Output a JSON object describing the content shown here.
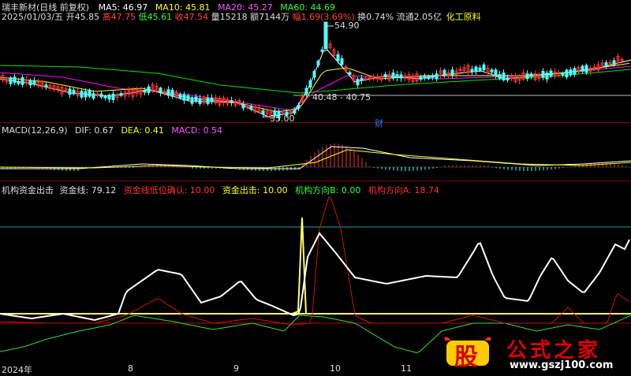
{
  "stock": {
    "title": "瑞丰新材(日线 前复权)",
    "date": "2025/01/03/五",
    "open_label": "开",
    "open_value": "45.85",
    "high_label": "高",
    "high_value": "47.75",
    "low_label": "低",
    "low_value": "45.61",
    "close_label": "收",
    "close_value": "47.54",
    "volume_label": "量",
    "volume_value": "15218",
    "amount_label": "额",
    "amount_value": "7144万",
    "change_label": "幅",
    "change_value": "1.69(3.69%)",
    "turnover_label": "换",
    "turnover_value": "0.74%",
    "float_label": "流通",
    "float_value": "2.05亿",
    "sector": "化工原料"
  },
  "ma": {
    "ma5": "MA5: 46.97",
    "ma10": "MA10: 45.81",
    "ma20": "MA20: 45.27",
    "ma60": "MA60: 44.69"
  },
  "price_annotations": {
    "peak": "54.90",
    "level": "40.48 - 40.75",
    "low": "35.00",
    "badge": "财"
  },
  "macd": {
    "title": "MACD(12,26,9)",
    "dif": "DIF: 0.67",
    "dea": "DEA: 0.41",
    "macd": "MACD: 0.54"
  },
  "indicator": {
    "title": "机构资金出击",
    "line1": "资金线: 79.12",
    "line2": "资金线低位确认: 10.00",
    "line3": "资金出击: 10.00",
    "line4": "机构方向B: 0.00",
    "line5": "机构方向A: 18.74"
  },
  "x_axis": [
    "2024年",
    "8",
    "9",
    "10",
    "11"
  ],
  "watermark": {
    "glyph": "股",
    "name": "公式之家",
    "url": "www.gszj100.com"
  },
  "colors": {
    "bg": "#000000",
    "up": "#ff3232",
    "down": "#54fcfc",
    "ma5": "#ffffff",
    "ma10": "#ffff00",
    "ma20": "#ff00ff",
    "ma60": "#00e000",
    "macd_purple": "#c050ff",
    "grid_red": "#800000"
  }
}
